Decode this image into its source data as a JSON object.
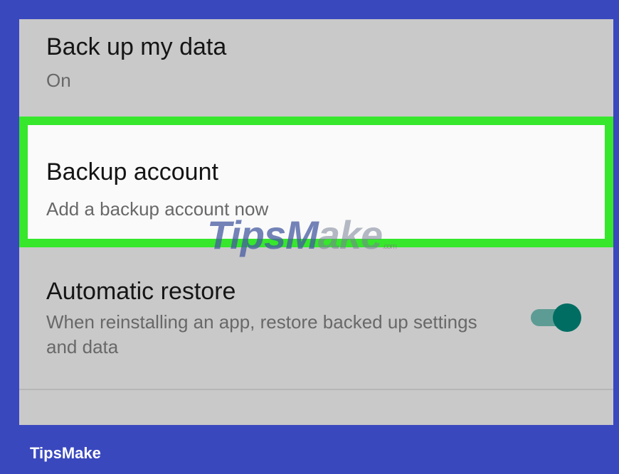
{
  "settings": {
    "backup_data": {
      "title": "Back up my data",
      "value": "On"
    },
    "backup_account": {
      "title": "Backup account",
      "subtitle": "Add a backup account now"
    },
    "auto_restore": {
      "title": "Automatic restore",
      "subtitle": "When reinstalling an app, restore backed up settings and data",
      "toggle_on": true
    }
  },
  "watermark": {
    "part1": "TipsM",
    "part2": "ake",
    "suffix": ".com"
  },
  "footer": {
    "brand": "TipsMake"
  },
  "colors": {
    "highlight": "#36e72c",
    "frame": "#3a48be",
    "toggle_on": "#006d62"
  }
}
